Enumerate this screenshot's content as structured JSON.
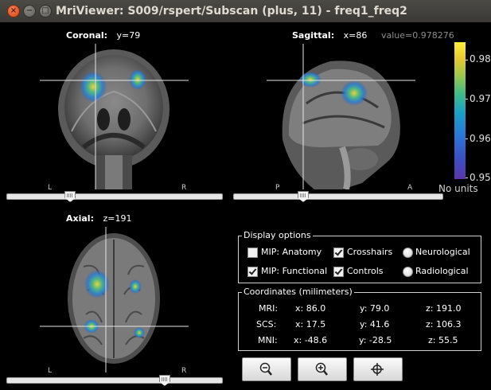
{
  "window": {
    "title": "MriViewer: S009/rspert/Subscan (plus, 11) - freq1_freq2",
    "close_glyph": "×",
    "minimize_glyph": "−",
    "maximize_glyph": "□"
  },
  "views": {
    "coronal": {
      "name": "Coronal:",
      "coord": "y=79",
      "left_label": "L",
      "right_label": "R",
      "slider_position": 0.28
    },
    "sagittal": {
      "name": "Sagittal:",
      "coord": "x=86",
      "value": "value=0.978276",
      "left_label": "P",
      "right_label": "A",
      "slider_position": 0.32
    },
    "axial": {
      "name": "Axial:",
      "coord": "z=191",
      "left_label": "L",
      "right_label": "R",
      "slider_position": 0.74
    }
  },
  "colorbar": {
    "ticks": [
      "0.98",
      "0.97",
      "0.96",
      "0.95"
    ],
    "units": "No units"
  },
  "display_options": {
    "title": "Display options",
    "mip_anatomy": {
      "label": "MIP: Anatomy",
      "checked": false
    },
    "mip_functional": {
      "label": "MIP: Functional",
      "checked": true
    },
    "crosshairs": {
      "label": "Crosshairs",
      "checked": true
    },
    "controls": {
      "label": "Controls",
      "checked": true
    },
    "neurological": {
      "label": "Neurological"
    },
    "radiological": {
      "label": "Radiological"
    }
  },
  "coordinates": {
    "title": "Coordinates (milimeters)",
    "rows": [
      {
        "label": "MRI:",
        "x": "x: 86.0",
        "y": "y: 79.0",
        "z": "z: 191.0"
      },
      {
        "label": "SCS:",
        "x": "x: 17.5",
        "y": "y: 41.6",
        "z": "z: 106.3"
      },
      {
        "label": "MNI:",
        "x": "x: -48.6",
        "y": "y: -28.5",
        "z": "z: 55.5"
      }
    ]
  },
  "toolbar": {
    "zoom_out_icon": "zoom-out-icon",
    "zoom_in_icon": "zoom-in-icon",
    "center_icon": "crosshair-target-icon"
  },
  "colors": {
    "background": "#000000",
    "titlebar": "#3c3b37",
    "activation_high": "#fff03a",
    "activation_low": "#3b4fc4"
  }
}
